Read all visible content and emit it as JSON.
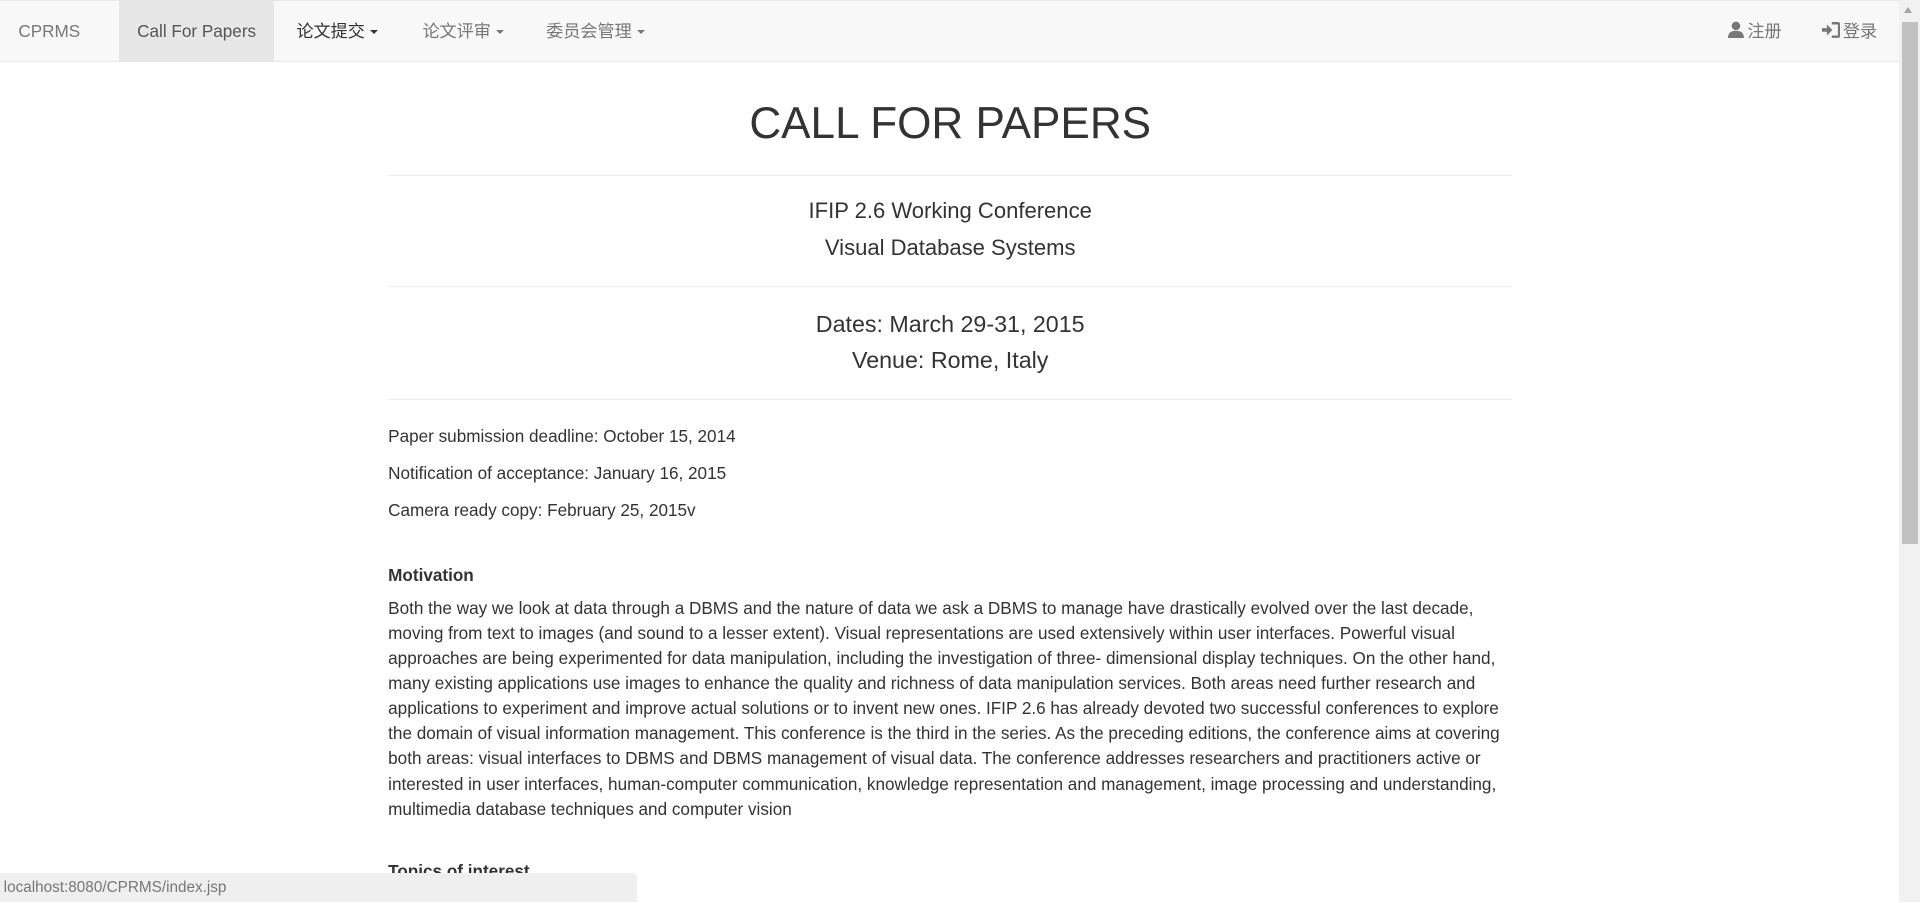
{
  "nav": {
    "brand": "CPRMS",
    "call_for_papers": "Call For Papers",
    "submit": "论文提交",
    "review": "论文评审",
    "committee": "委员会管理",
    "register": "注册",
    "login": "登录"
  },
  "main": {
    "title": "CALL FOR PAPERS",
    "conf_line1": "IFIP 2.6 Working Conference",
    "conf_line2": "Visual Database Systems",
    "dates": "Dates: March 29-31, 2015",
    "venue": "Venue: Rome, Italy",
    "deadlines": [
      "Paper submission deadline: October 15, 2014",
      "Notification of acceptance: January 16, 2015",
      "Camera ready copy: February 25, 2015v"
    ],
    "motivation_heading": "Motivation",
    "motivation_text": "Both the way we look at data through a DBMS and the nature of data we ask a DBMS to manage have drastically evolved over the last decade, moving from text to images (and sound to a lesser extent). Visual representations are used extensively within user interfaces. Powerful visual approaches are being experimented for data manipulation, including the investigation of three- dimensional display techniques. On the other hand, many existing applications use images to enhance the quality and richness of data manipulation services. Both areas need further research and applications to experiment and improve actual solutions or to invent new ones. IFIP 2.6 has already devoted two successful conferences to explore the domain of visual information management. This conference is the third in the series. As the preceding editions, the conference aims at covering both areas: visual interfaces to DBMS and DBMS management of visual data. The conference addresses researchers and practitioners active or interested in user interfaces, human-computer communication, knowledge representation and management, image processing and understanding, multimedia database techniques and computer vision",
    "topics_heading": "Topics of interest"
  },
  "status_url": "localhost:8080/CPRMS/index.jsp"
}
